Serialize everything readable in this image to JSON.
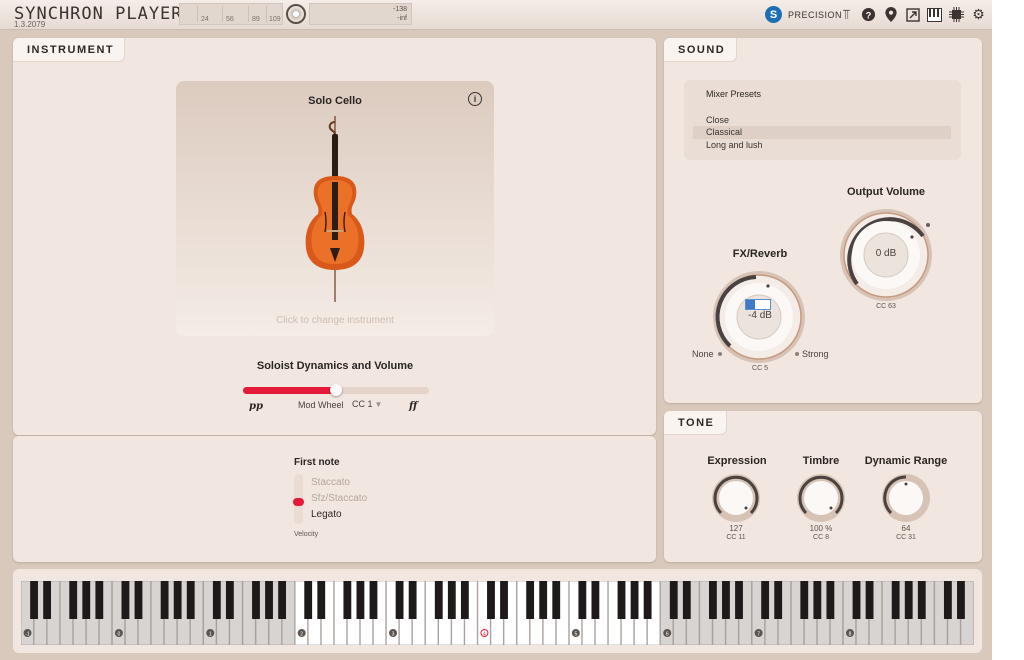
{
  "app": {
    "title": "SYNCHRON PLAYER",
    "version": "1.3.2079"
  },
  "meter": {
    "ticks": [
      "24",
      "56",
      "89",
      "109"
    ],
    "level_top": "-138",
    "level_bottom": "-inf"
  },
  "toolbar": {
    "brand_label": "PRECISION",
    "icons": [
      "tuning-fork-icon",
      "help-icon",
      "location-pin-icon",
      "resize-icon",
      "piano-keys-icon",
      "cpu-chip-icon",
      "gear-icon"
    ]
  },
  "instrument": {
    "tab_label": "INSTRUMENT",
    "name": "Solo Cello",
    "change_hint": "Click to change instrument",
    "dynamics_title": "Soloist Dynamics and Volume",
    "dynamics_value": 0.5,
    "pp_label": "pp",
    "ff_label": "ff",
    "mod_wheel_label": "Mod Wheel",
    "cc_select": "CC 1"
  },
  "first_note": {
    "title": "First note",
    "options": [
      "Staccato",
      "Sfz/Staccato",
      "Legato"
    ],
    "selected": "Sfz/Staccato",
    "velocity_label": "Velocity"
  },
  "sound": {
    "tab_label": "SOUND",
    "mixer_presets_label": "Mixer Presets",
    "presets": [
      "Close",
      "Classical",
      "Long and lush"
    ],
    "selected_preset": "Classical",
    "output_volume": {
      "label": "Output Volume",
      "value": "0 dB",
      "cc": "CC 63"
    },
    "fx_reverb": {
      "label": "FX/Reverb",
      "value": "-4 dB",
      "cc": "CC 5",
      "min_label": "None",
      "max_label": "Strong"
    }
  },
  "tone": {
    "tab_label": "TONE",
    "knobs": [
      {
        "label": "Expression",
        "value": "127",
        "cc": "CC 11"
      },
      {
        "label": "Timbre",
        "value": "100 %",
        "cc": "CC 8"
      },
      {
        "label": "Dynamic Range",
        "value": "64",
        "cc": "CC 31"
      }
    ]
  },
  "keyboard": {
    "octave_labels": [
      "-1",
      "0",
      "1",
      "2",
      "3",
      "4",
      "5",
      "6",
      "7",
      "8"
    ],
    "highlight_octave": "4",
    "playable_range_start_octave": "2",
    "playable_range_end_octave": "5"
  },
  "colors": {
    "accent": "#e51a38",
    "panel": "#f1e7e0",
    "frame": "#d9c9bc",
    "brand": "#1d6fb5"
  }
}
